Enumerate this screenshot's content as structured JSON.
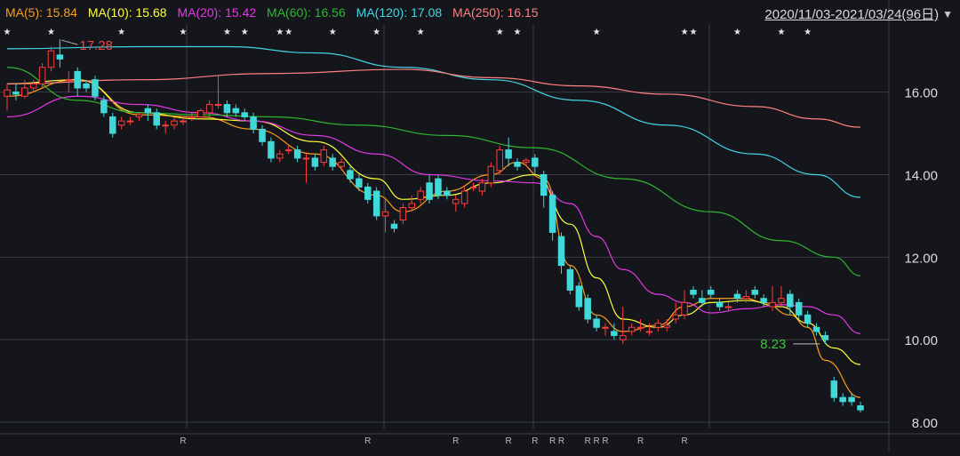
{
  "legend": [
    {
      "label": "MA(5): 15.84",
      "color": "#ff9c1a"
    },
    {
      "label": "MA(10): 15.68",
      "color": "#ffff3a"
    },
    {
      "label": "MA(20): 15.42",
      "color": "#e438e4"
    },
    {
      "label": "MA(60): 16.56",
      "color": "#2fb52f"
    },
    {
      "label": "MA(120): 17.08",
      "color": "#45d4e4"
    },
    {
      "label": "MA(250): 16.15",
      "color": "#ff8080"
    }
  ],
  "range_label": "2020/11/03-2021/03/24(96日)",
  "dropdown_icon": "triangle-down-icon",
  "marker_icon": "star-icon",
  "star_glyph": "★",
  "r_glyph": "R",
  "colors": {
    "up": "#ff3b3b",
    "down": "#40d8d8",
    "grid": "#3a3d44",
    "axis_text": "#dcdcdc",
    "high_label": "#e84a4a",
    "low_label": "#3ec63e"
  },
  "chart_data": {
    "type": "candlestick",
    "ylim": [
      7.85,
      17.65
    ],
    "yticks": [
      "8.00",
      "10.00",
      "12.00",
      "14.00",
      "16.00"
    ],
    "high_marker": {
      "text": "17.28",
      "index": 6
    },
    "low_marker": {
      "text": "8.23",
      "index": 93
    },
    "star_indices": [
      0,
      5,
      13,
      20,
      25,
      27,
      31,
      32,
      37,
      42,
      47,
      56,
      58,
      67,
      77,
      78,
      83,
      88,
      91
    ],
    "r_indices": [
      20,
      41,
      51,
      57,
      60,
      62,
      63,
      66,
      67,
      68,
      72,
      77
    ],
    "candles": [
      [
        15.9,
        16.05,
        15.55,
        16.2
      ],
      [
        16.0,
        15.95,
        15.8,
        16.2
      ],
      [
        15.9,
        16.1,
        15.85,
        16.3
      ],
      [
        16.1,
        16.2,
        16.0,
        16.3
      ],
      [
        16.2,
        16.6,
        16.1,
        16.7
      ],
      [
        16.6,
        17.0,
        16.5,
        17.1
      ],
      [
        16.9,
        16.8,
        16.6,
        17.28
      ],
      [
        16.3,
        16.3,
        16.0,
        16.5
      ],
      [
        16.5,
        16.1,
        15.9,
        16.6
      ],
      [
        16.2,
        16.1,
        16.0,
        16.3
      ],
      [
        16.3,
        15.9,
        15.8,
        16.4
      ],
      [
        15.8,
        15.5,
        15.4,
        15.9
      ],
      [
        15.4,
        15.0,
        14.9,
        15.5
      ],
      [
        15.2,
        15.3,
        15.1,
        15.4
      ],
      [
        15.3,
        15.3,
        15.2,
        15.4
      ],
      [
        15.4,
        15.45,
        15.3,
        15.5
      ],
      [
        15.6,
        15.5,
        15.3,
        15.7
      ],
      [
        15.5,
        15.2,
        15.1,
        15.6
      ],
      [
        15.2,
        15.2,
        15.0,
        15.3
      ],
      [
        15.2,
        15.3,
        15.1,
        15.4
      ],
      [
        15.3,
        15.3,
        15.2,
        15.4
      ],
      [
        15.4,
        15.4,
        15.3,
        15.5
      ],
      [
        15.4,
        15.55,
        15.35,
        15.6
      ],
      [
        15.5,
        15.7,
        15.4,
        15.8
      ],
      [
        15.7,
        15.7,
        15.6,
        16.4
      ],
      [
        15.7,
        15.5,
        15.4,
        15.8
      ],
      [
        15.6,
        15.5,
        15.4,
        15.7
      ],
      [
        15.5,
        15.4,
        15.3,
        15.6
      ],
      [
        15.4,
        15.1,
        15.0,
        15.5
      ],
      [
        15.1,
        14.8,
        14.7,
        15.2
      ],
      [
        14.8,
        14.4,
        14.3,
        14.9
      ],
      [
        14.4,
        14.5,
        14.3,
        14.6
      ],
      [
        14.6,
        14.6,
        14.5,
        14.7
      ],
      [
        14.6,
        14.4,
        14.3,
        14.7
      ],
      [
        14.4,
        14.4,
        13.8,
        14.5
      ],
      [
        14.4,
        14.2,
        14.1,
        14.5
      ],
      [
        14.3,
        14.6,
        14.2,
        14.7
      ],
      [
        14.4,
        14.2,
        14.1,
        14.5
      ],
      [
        14.2,
        14.3,
        14.1,
        14.4
      ],
      [
        14.1,
        13.9,
        13.8,
        14.2
      ],
      [
        13.9,
        13.7,
        13.6,
        14.0
      ],
      [
        13.7,
        13.4,
        13.3,
        13.8
      ],
      [
        13.6,
        13.0,
        12.9,
        13.7
      ],
      [
        13.0,
        13.1,
        12.6,
        13.4
      ],
      [
        12.8,
        12.7,
        12.6,
        12.9
      ],
      [
        12.9,
        13.2,
        12.8,
        13.3
      ],
      [
        13.2,
        13.3,
        13.1,
        13.5
      ],
      [
        13.4,
        13.6,
        13.3,
        13.7
      ],
      [
        13.8,
        13.4,
        13.3,
        14.0
      ],
      [
        13.9,
        13.5,
        13.4,
        14.0
      ],
      [
        13.6,
        13.5,
        13.4,
        13.7
      ],
      [
        13.3,
        13.4,
        13.1,
        13.5
      ],
      [
        13.3,
        13.6,
        13.2,
        13.7
      ],
      [
        13.7,
        13.7,
        13.6,
        13.8
      ],
      [
        13.6,
        13.8,
        13.5,
        13.9
      ],
      [
        13.8,
        14.2,
        13.7,
        14.3
      ],
      [
        14.1,
        14.6,
        14.0,
        14.7
      ],
      [
        14.6,
        14.4,
        14.2,
        14.9
      ],
      [
        14.3,
        14.2,
        14.1,
        14.4
      ],
      [
        14.3,
        14.35,
        14.2,
        14.4
      ],
      [
        14.4,
        14.2,
        14.0,
        14.5
      ],
      [
        14.0,
        13.5,
        13.2,
        14.1
      ],
      [
        13.5,
        12.6,
        12.4,
        13.6
      ],
      [
        12.5,
        11.8,
        11.6,
        12.6
      ],
      [
        11.7,
        11.2,
        11.1,
        11.8
      ],
      [
        11.3,
        10.8,
        10.7,
        11.4
      ],
      [
        11.0,
        10.5,
        10.4,
        11.1
      ],
      [
        10.5,
        10.3,
        10.2,
        10.6
      ],
      [
        10.3,
        10.3,
        10.1,
        10.4
      ],
      [
        10.2,
        10.1,
        10.0,
        10.4
      ],
      [
        10.0,
        10.1,
        9.9,
        10.8
      ],
      [
        10.2,
        10.3,
        10.1,
        10.4
      ],
      [
        10.3,
        10.3,
        10.2,
        10.5
      ],
      [
        10.2,
        10.2,
        10.1,
        10.4
      ],
      [
        10.3,
        10.4,
        10.2,
        10.5
      ],
      [
        10.3,
        10.35,
        10.2,
        10.5
      ],
      [
        10.5,
        10.6,
        10.4,
        10.9
      ],
      [
        10.6,
        10.9,
        10.5,
        11.2
      ],
      [
        11.2,
        11.1,
        11.0,
        11.3
      ],
      [
        11.0,
        10.9,
        10.8,
        11.2
      ],
      [
        11.2,
        11.1,
        11.0,
        11.3
      ],
      [
        10.9,
        10.8,
        10.7,
        11.0
      ],
      [
        10.8,
        10.8,
        10.7,
        10.9
      ],
      [
        11.1,
        11.0,
        10.9,
        11.2
      ],
      [
        11.0,
        11.05,
        10.9,
        11.2
      ],
      [
        11.2,
        11.1,
        11.0,
        11.3
      ],
      [
        11.0,
        10.9,
        10.8,
        11.1
      ],
      [
        10.8,
        10.9,
        10.7,
        11.3
      ],
      [
        10.9,
        11.0,
        10.8,
        11.3
      ],
      [
        11.1,
        10.8,
        10.6,
        11.2
      ],
      [
        10.9,
        10.6,
        10.5,
        11.0
      ],
      [
        10.6,
        10.4,
        10.3,
        10.7
      ],
      [
        10.3,
        10.2,
        10.1,
        10.4
      ],
      [
        10.1,
        10.0,
        9.9,
        10.2
      ],
      [
        9.0,
        8.6,
        8.5,
        9.1
      ],
      [
        8.6,
        8.5,
        8.4,
        8.7
      ],
      [
        8.6,
        8.5,
        8.4,
        8.7
      ],
      [
        8.4,
        8.3,
        8.23,
        8.5
      ]
    ],
    "ma_series": {
      "MA(5)": [
        [
          0,
          15.9
        ],
        [
          8,
          16.3
        ],
        [
          15,
          15.45
        ],
        [
          22,
          15.4
        ],
        [
          28,
          15.1
        ],
        [
          35,
          14.5
        ],
        [
          42,
          13.5
        ],
        [
          45,
          13.1
        ],
        [
          50,
          13.6
        ],
        [
          55,
          14.0
        ],
        [
          58,
          14.3
        ],
        [
          61,
          13.9
        ],
        [
          64,
          11.8
        ],
        [
          67,
          10.6
        ],
        [
          70,
          10.2
        ],
        [
          74,
          10.35
        ],
        [
          77,
          10.8
        ],
        [
          80,
          11.0
        ],
        [
          84,
          11.0
        ],
        [
          86,
          10.9
        ],
        [
          89,
          10.6
        ],
        [
          91,
          10.3
        ],
        [
          93,
          9.5
        ],
        [
          97,
          8.6
        ]
      ],
      "MA(10)": [
        [
          0,
          16.2
        ],
        [
          8,
          16.3
        ],
        [
          15,
          15.5
        ],
        [
          22,
          15.35
        ],
        [
          28,
          15.3
        ],
        [
          35,
          14.8
        ],
        [
          42,
          13.9
        ],
        [
          45,
          13.4
        ],
        [
          50,
          13.5
        ],
        [
          55,
          13.8
        ],
        [
          60,
          14.0
        ],
        [
          64,
          12.8
        ],
        [
          67,
          11.5
        ],
        [
          70,
          10.5
        ],
        [
          74,
          10.3
        ],
        [
          77,
          10.6
        ],
        [
          80,
          10.9
        ],
        [
          84,
          10.95
        ],
        [
          88,
          10.8
        ],
        [
          91,
          10.4
        ],
        [
          94,
          9.8
        ],
        [
          97,
          9.4
        ]
      ],
      "MA(20)": [
        [
          0,
          15.4
        ],
        [
          8,
          15.9
        ],
        [
          15,
          15.7
        ],
        [
          22,
          15.5
        ],
        [
          28,
          15.3
        ],
        [
          35,
          14.95
        ],
        [
          42,
          14.5
        ],
        [
          48,
          14.0
        ],
        [
          55,
          13.85
        ],
        [
          60,
          13.8
        ],
        [
          64,
          13.3
        ],
        [
          67,
          12.5
        ],
        [
          70,
          11.7
        ],
        [
          74,
          11.1
        ],
        [
          77,
          10.9
        ],
        [
          80,
          10.65
        ],
        [
          84,
          10.75
        ],
        [
          88,
          10.85
        ],
        [
          91,
          10.8
        ],
        [
          94,
          10.6
        ],
        [
          97,
          10.15
        ]
      ],
      "MA(60)": [
        [
          0,
          16.6
        ],
        [
          8,
          15.8
        ],
        [
          15,
          15.5
        ],
        [
          22,
          15.45
        ],
        [
          30,
          15.4
        ],
        [
          40,
          15.2
        ],
        [
          50,
          14.95
        ],
        [
          60,
          14.65
        ],
        [
          70,
          13.9
        ],
        [
          80,
          13.1
        ],
        [
          88,
          12.4
        ],
        [
          94,
          12.0
        ],
        [
          97,
          11.55
        ]
      ],
      "MA(120)": [
        [
          0,
          17.05
        ],
        [
          15,
          17.1
        ],
        [
          25,
          17.1
        ],
        [
          35,
          16.95
        ],
        [
          45,
          16.6
        ],
        [
          55,
          16.3
        ],
        [
          65,
          15.8
        ],
        [
          75,
          15.2
        ],
        [
          85,
          14.5
        ],
        [
          92,
          14.0
        ],
        [
          97,
          13.45
        ]
      ],
      "MA(250)": [
        [
          0,
          16.2
        ],
        [
          15,
          16.3
        ],
        [
          30,
          16.45
        ],
        [
          45,
          16.55
        ],
        [
          55,
          16.35
        ],
        [
          65,
          16.15
        ],
        [
          75,
          15.95
        ],
        [
          85,
          15.65
        ],
        [
          92,
          15.35
        ],
        [
          97,
          15.15
        ]
      ]
    }
  }
}
